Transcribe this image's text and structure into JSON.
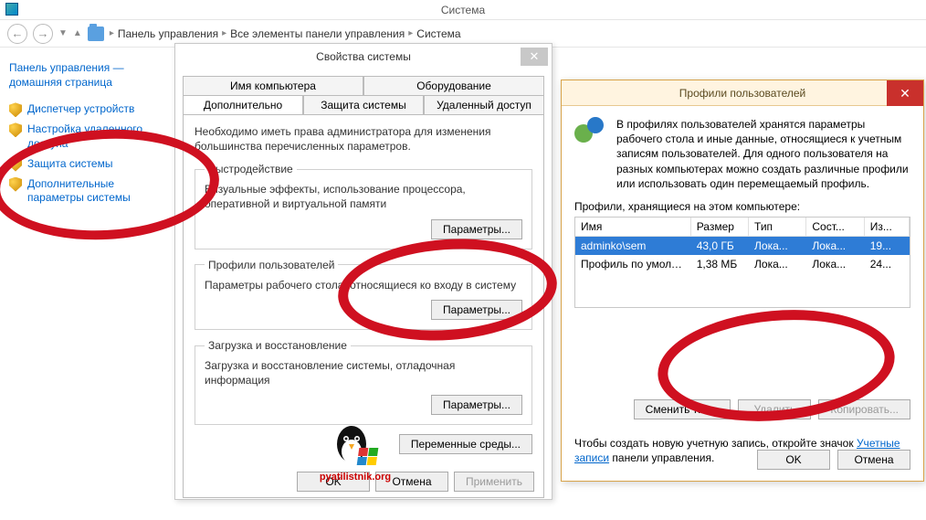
{
  "window": {
    "title": "Система"
  },
  "breadcrumb": {
    "items": [
      "Панель управления",
      "Все элементы панели управления",
      "Система"
    ]
  },
  "sidebar": {
    "home": "Панель управления — домашняя страница",
    "links": [
      "Диспетчер устройств",
      "Настройка удаленного доступа",
      "Защита системы",
      "Дополнительные параметры системы"
    ]
  },
  "sysprops": {
    "title": "Свойства системы",
    "tabs_row1": [
      "Имя компьютера",
      "Оборудование"
    ],
    "tabs_row2": [
      "Дополнительно",
      "Защита системы",
      "Удаленный доступ"
    ],
    "active_tab": "Дополнительно",
    "desc": "Необходимо иметь права администратора для изменения большинства перечисленных параметров.",
    "perf": {
      "legend": "Быстродействие",
      "text": "Визуальные эффекты, использование процессора, оперативной и виртуальной памяти",
      "btn": "Параметры..."
    },
    "profiles": {
      "legend": "Профили пользователей",
      "text": "Параметры рабочего стола, относящиеся ко входу в систему",
      "btn": "Параметры..."
    },
    "startup": {
      "legend": "Загрузка и восстановление",
      "text": "Загрузка и восстановление системы, отладочная информация",
      "btn": "Параметры..."
    },
    "env_btn": "Переменные среды...",
    "footer": {
      "ok": "OK",
      "cancel": "Отмена",
      "apply": "Применить"
    }
  },
  "profdlg": {
    "title": "Профили пользователей",
    "intro": "В профилях пользователей хранятся параметры рабочего стола и иные данные, относящиеся к учетным записям пользователей. Для одного пользователя на разных компьютерах можно создать различные профили или использовать один перемещаемый профиль.",
    "stored_label": "Профили, хранящиеся на этом компьютере:",
    "columns": [
      "Имя",
      "Размер",
      "Тип",
      "Сост...",
      "Из..."
    ],
    "rows": [
      {
        "name": "adminko\\sem",
        "size": "43,0 ГБ",
        "type": "Лока...",
        "state": "Лока...",
        "changed": "19...",
        "selected": true
      },
      {
        "name": "Профиль по умолчанию",
        "size": "1,38 МБ",
        "type": "Лока...",
        "state": "Лока...",
        "changed": "24...",
        "selected": false
      }
    ],
    "actions": {
      "change_type": "Сменить тип...",
      "delete": "Удалить",
      "copy": "Копировать..."
    },
    "note_pre": "Чтобы создать новую учетную запись, откройте значок ",
    "note_link": "Учетные записи",
    "note_post": " панели управления.",
    "footer": {
      "ok": "OK",
      "cancel": "Отмена"
    }
  },
  "logo_text": "pyatilistnik.org"
}
